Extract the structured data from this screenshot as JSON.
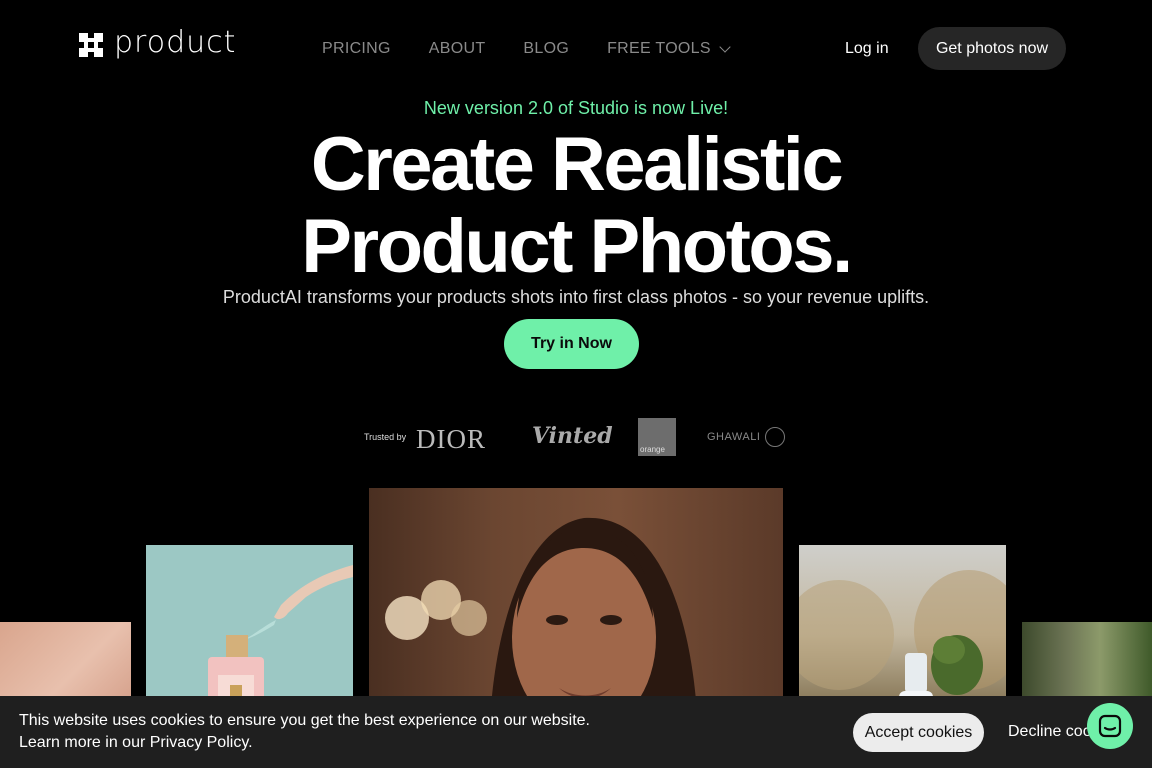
{
  "brand": {
    "name": "product"
  },
  "nav": {
    "links": [
      "PRICING",
      "ABOUT",
      "BLOG",
      "FREE TOOLS"
    ],
    "login": "Log in",
    "cta": "Get photos now"
  },
  "hero": {
    "announcement": "New version 2.0 of Studio is now Live!",
    "headline": "Create Realistic Product Photos.",
    "subheadline": "ProductAI transforms your products shots into first class photos - so your revenue uplifts.",
    "cta": "Try in Now"
  },
  "trusted": {
    "label": "Trusted by",
    "logos": [
      "DIOR",
      "Vinted",
      "orange",
      "GHAWALI"
    ]
  },
  "cookie": {
    "line1": "This website uses cookies to ensure you get the best experience on our website.",
    "line2": "Learn more in our Privacy Policy.",
    "accept": "Accept cookies",
    "decline": "Decline coo"
  },
  "colors": {
    "accent": "#6ff0a9",
    "background": "#000000",
    "cookie_bg": "#1f1f1f"
  },
  "icons": {
    "logo": "product-logo-icon",
    "chevron": "chevron-down-icon",
    "chat": "chat-icon"
  }
}
